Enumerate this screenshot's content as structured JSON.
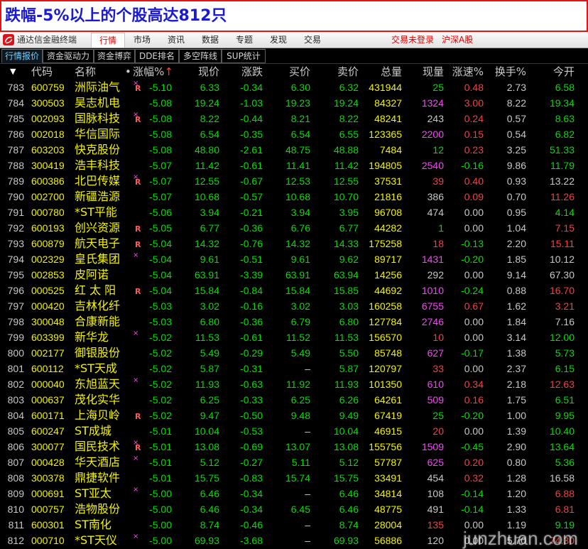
{
  "banner": {
    "text": "跌幅-5%以上的个股高达812只"
  },
  "menubar": {
    "logo_icon": "tdx-logo-icon",
    "app_title": "通达信金融终端",
    "tabs": [
      "行情",
      "市场",
      "资讯",
      "数据",
      "专题",
      "发现",
      "交易"
    ],
    "active_tab": 0,
    "login_status": "交易未登录",
    "market": "沪深A股"
  },
  "subtabs": {
    "items": [
      "行情报价",
      "资金驱动力",
      "资金博弈",
      "DDE排名",
      "多空阵线",
      "SUP统计"
    ],
    "active": 0
  },
  "table": {
    "columns": {
      "sort_icon": "▼",
      "code": "代码",
      "name": "名称",
      "dot": "•",
      "pct": "涨幅%",
      "pct_arrow": "↑",
      "price": "现价",
      "chg": "涨跌",
      "bid": "买价",
      "ask": "卖价",
      "vol": "总量",
      "cur_vol": "现量",
      "speed": "涨速%",
      "turnover": "换手%",
      "open": "今开"
    },
    "rows": [
      {
        "no": "783",
        "code": "600759",
        "name": "洲际油气",
        "mx": "×",
        "mr": "R",
        "pct": "-5.10",
        "price": "6.33",
        "chg": "-0.34",
        "bid": "6.30",
        "ask": "6.32",
        "vol": "431944",
        "cur_vol": "25",
        "cur_vol_color": "#00e000",
        "speed": "0.48",
        "turn": "2.73",
        "open": "6.58"
      },
      {
        "no": "784",
        "code": "300503",
        "name": "昊志机电",
        "pct": "-5.08",
        "price": "19.24",
        "chg": "-1.03",
        "bid": "19.23",
        "ask": "19.24",
        "vol": "84327",
        "cur_vol": "1324",
        "cur_vol_color": "#ff40ff",
        "speed": "3.00",
        "turn": "8.22",
        "open": "19.34"
      },
      {
        "no": "785",
        "code": "002093",
        "name": "国脉科技",
        "mx": "×",
        "mr": "R",
        "pct": "-5.08",
        "price": "8.22",
        "chg": "-0.44",
        "bid": "8.21",
        "ask": "8.22",
        "vol": "48241",
        "cur_vol": "243",
        "cur_vol_color": "#c8c8c8",
        "speed": "0.24",
        "turn": "0.57",
        "open": "8.63"
      },
      {
        "no": "786",
        "code": "002018",
        "name": "华信国际",
        "pct": "-5.08",
        "price": "6.54",
        "chg": "-0.35",
        "bid": "6.54",
        "ask": "6.55",
        "vol": "123365",
        "cur_vol": "2200",
        "cur_vol_color": "#ff40ff",
        "speed": "0.15",
        "turn": "0.54",
        "open": "6.82"
      },
      {
        "no": "787",
        "code": "603203",
        "name": "快克股份",
        "pct": "-5.08",
        "price": "48.80",
        "chg": "-2.61",
        "bid": "48.75",
        "ask": "48.88",
        "vol": "7484",
        "cur_vol": "12",
        "cur_vol_color": "#00e000",
        "speed": "0.23",
        "turn": "3.25",
        "open": "51.33"
      },
      {
        "no": "788",
        "code": "300419",
        "name": "浩丰科技",
        "pct": "-5.07",
        "price": "11.42",
        "chg": "-0.61",
        "bid": "11.41",
        "ask": "11.42",
        "vol": "194805",
        "cur_vol": "2540",
        "cur_vol_color": "#ff40ff",
        "speed": "-0.16",
        "turn": "9.86",
        "open": "11.79"
      },
      {
        "no": "789",
        "code": "600386",
        "name": "北巴传媒",
        "mx": "×",
        "mr": "R",
        "pct": "-5.07",
        "price": "12.55",
        "chg": "-0.67",
        "bid": "12.53",
        "ask": "12.55",
        "vol": "37531",
        "cur_vol": "39",
        "cur_vol_color": "#ff3c3c",
        "speed": "0.40",
        "turn": "0.93",
        "open": "13.22"
      },
      {
        "no": "790",
        "code": "002700",
        "name": "新疆浩源",
        "pct": "-5.07",
        "price": "10.68",
        "chg": "-0.57",
        "bid": "10.68",
        "ask": "10.70",
        "vol": "21816",
        "cur_vol": "386",
        "cur_vol_color": "#c8c8c8",
        "speed": "0.09",
        "turn": "0.70",
        "open": "11.26"
      },
      {
        "no": "791",
        "code": "000780",
        "name": "*ST平能",
        "pct": "-5.06",
        "price": "3.94",
        "chg": "-0.21",
        "bid": "3.94",
        "ask": "3.95",
        "vol": "96708",
        "cur_vol": "474",
        "cur_vol_color": "#c8c8c8",
        "speed": "0.00",
        "turn": "0.95",
        "open": "4.14"
      },
      {
        "no": "792",
        "code": "600193",
        "name": "创兴资源",
        "mr": "R",
        "pct": "-5.05",
        "price": "6.77",
        "chg": "-0.36",
        "bid": "6.76",
        "ask": "6.77",
        "vol": "44282",
        "cur_vol": "1",
        "cur_vol_color": "#00e000",
        "speed": "0.00",
        "turn": "1.04",
        "open": "7.15"
      },
      {
        "no": "793",
        "code": "600879",
        "name": "航天电子",
        "mr": "R",
        "pct": "-5.04",
        "price": "14.32",
        "chg": "-0.76",
        "bid": "14.32",
        "ask": "14.33",
        "vol": "175258",
        "cur_vol": "18",
        "cur_vol_color": "#ff3c3c",
        "speed": "-0.13",
        "turn": "2.20",
        "open": "15.11"
      },
      {
        "no": "794",
        "code": "002329",
        "name": "皇氏集团",
        "mx": "×",
        "pct": "-5.04",
        "price": "9.61",
        "chg": "-0.51",
        "bid": "9.61",
        "ask": "9.62",
        "vol": "89717",
        "cur_vol": "1431",
        "cur_vol_color": "#ff40ff",
        "speed": "-0.20",
        "turn": "1.85",
        "open": "10.12"
      },
      {
        "no": "795",
        "code": "002853",
        "name": "皮阿诺",
        "pct": "-5.04",
        "price": "63.91",
        "chg": "-3.39",
        "bid": "63.91",
        "ask": "63.94",
        "vol": "14256",
        "cur_vol": "292",
        "cur_vol_color": "#c8c8c8",
        "speed": "0.00",
        "turn": "9.14",
        "open": "67.30"
      },
      {
        "no": "796",
        "code": "000525",
        "name": "红 太 阳",
        "mr": "R",
        "pct": "-5.04",
        "price": "15.84",
        "chg": "-0.84",
        "bid": "15.84",
        "ask": "15.85",
        "vol": "44692",
        "cur_vol": "1010",
        "cur_vol_color": "#ff40ff",
        "speed": "-0.24",
        "turn": "0.88",
        "open": "16.70"
      },
      {
        "no": "797",
        "code": "000420",
        "name": "吉林化纤",
        "pct": "-5.03",
        "price": "3.02",
        "chg": "-0.16",
        "bid": "3.02",
        "ask": "3.03",
        "vol": "160258",
        "cur_vol": "6755",
        "cur_vol_color": "#ff40ff",
        "speed": "0.67",
        "turn": "1.62",
        "open": "3.21"
      },
      {
        "no": "798",
        "code": "300048",
        "name": "合康新能",
        "pct": "-5.03",
        "price": "6.80",
        "chg": "-0.36",
        "bid": "6.79",
        "ask": "6.80",
        "vol": "127784",
        "cur_vol": "2746",
        "cur_vol_color": "#ff40ff",
        "speed": "0.00",
        "turn": "1.84",
        "open": "7.16"
      },
      {
        "no": "799",
        "code": "603399",
        "name": "新华龙",
        "mx": "×",
        "pct": "-5.02",
        "price": "11.53",
        "chg": "-0.61",
        "bid": "11.52",
        "ask": "11.53",
        "vol": "156570",
        "cur_vol": "10",
        "cur_vol_color": "#ff3c3c",
        "speed": "0.00",
        "turn": "3.14",
        "open": "12.00"
      },
      {
        "no": "800",
        "code": "002177",
        "name": "御银股份",
        "pct": "-5.02",
        "price": "5.49",
        "chg": "-0.29",
        "bid": "5.49",
        "ask": "5.50",
        "vol": "85748",
        "cur_vol": "627",
        "cur_vol_color": "#ff40ff",
        "speed": "-0.17",
        "turn": "1.38",
        "open": "5.73"
      },
      {
        "no": "801",
        "code": "600112",
        "name": "*ST天成",
        "pct": "-5.02",
        "price": "5.87",
        "chg": "-0.31",
        "bid": "–",
        "ask": "5.87",
        "vol": "120797",
        "cur_vol": "33",
        "cur_vol_color": "#ff3c3c",
        "speed": "0.00",
        "turn": "2.37",
        "open": "6.15"
      },
      {
        "no": "802",
        "code": "000040",
        "name": "东旭蓝天",
        "mx": "×",
        "pct": "-5.02",
        "price": "11.93",
        "chg": "-0.63",
        "bid": "11.92",
        "ask": "11.93",
        "vol": "101350",
        "cur_vol": "610",
        "cur_vol_color": "#ff40ff",
        "speed": "0.34",
        "turn": "2.18",
        "open": "12.63"
      },
      {
        "no": "803",
        "code": "000637",
        "name": "茂化实华",
        "pct": "-5.02",
        "price": "6.25",
        "chg": "-0.33",
        "bid": "6.25",
        "ask": "6.26",
        "vol": "64261",
        "cur_vol": "509",
        "cur_vol_color": "#ff40ff",
        "speed": "0.16",
        "turn": "1.75",
        "open": "6.51"
      },
      {
        "no": "804",
        "code": "600171",
        "name": "上海贝岭",
        "mr": "R",
        "pct": "-5.02",
        "price": "9.47",
        "chg": "-0.50",
        "bid": "9.48",
        "ask": "9.49",
        "vol": "67419",
        "cur_vol": "25",
        "cur_vol_color": "#00e000",
        "speed": "-0.20",
        "turn": "1.00",
        "open": "9.95"
      },
      {
        "no": "805",
        "code": "600247",
        "name": "ST成城",
        "pct": "-5.01",
        "price": "10.04",
        "chg": "-0.53",
        "bid": "–",
        "ask": "10.04",
        "vol": "46915",
        "cur_vol": "20",
        "cur_vol_color": "#ff3c3c",
        "speed": "0.00",
        "turn": "1.39",
        "open": "10.40"
      },
      {
        "no": "806",
        "code": "300077",
        "name": "国民技术",
        "mx": "×",
        "mr": "R",
        "pct": "-5.01",
        "price": "13.08",
        "chg": "-0.69",
        "bid": "13.07",
        "ask": "13.08",
        "vol": "155756",
        "cur_vol": "1509",
        "cur_vol_color": "#ff40ff",
        "speed": "-0.45",
        "turn": "2.90",
        "open": "13.64"
      },
      {
        "no": "807",
        "code": "000428",
        "name": "华天酒店",
        "mx": "×",
        "pct": "-5.01",
        "price": "5.12",
        "chg": "-0.27",
        "bid": "5.11",
        "ask": "5.12",
        "vol": "57787",
        "cur_vol": "625",
        "cur_vol_color": "#ff40ff",
        "speed": "0.20",
        "turn": "0.80",
        "open": "5.36"
      },
      {
        "no": "808",
        "code": "300378",
        "name": "鼎捷软件",
        "pct": "-5.01",
        "price": "15.75",
        "chg": "-0.83",
        "bid": "15.74",
        "ask": "15.75",
        "vol": "33491",
        "cur_vol": "454",
        "cur_vol_color": "#c8c8c8",
        "speed": "0.32",
        "turn": "1.28",
        "open": "16.58"
      },
      {
        "no": "809",
        "code": "000691",
        "name": "ST亚太",
        "mx": "×",
        "pct": "-5.00",
        "price": "6.46",
        "chg": "-0.34",
        "bid": "–",
        "ask": "6.46",
        "vol": "34814",
        "cur_vol": "108",
        "cur_vol_color": "#c8c8c8",
        "speed": "-0.14",
        "turn": "1.20",
        "open": "6.88"
      },
      {
        "no": "810",
        "code": "000757",
        "name": "浩物股份",
        "pct": "-5.00",
        "price": "6.46",
        "chg": "-0.34",
        "bid": "6.45",
        "ask": "6.46",
        "vol": "48775",
        "cur_vol": "491",
        "cur_vol_color": "#c8c8c8",
        "speed": "-0.14",
        "turn": "1.33",
        "open": "6.81"
      },
      {
        "no": "811",
        "code": "600301",
        "name": "ST南化",
        "pct": "-5.00",
        "price": "8.74",
        "chg": "-0.46",
        "bid": "–",
        "ask": "8.74",
        "vol": "28004",
        "cur_vol": "135",
        "cur_vol_color": "#ff3c3c",
        "speed": "0.00",
        "turn": "1.19",
        "open": "9.19"
      },
      {
        "no": "812",
        "code": "000710",
        "name": "*ST天仪",
        "mx": "×",
        "pct": "-5.00",
        "price": "69.93",
        "chg": "-3.68",
        "bid": "–",
        "ask": "69.93",
        "vol": "56886",
        "cur_vol": "120",
        "cur_vol_color": "#c8c8c8",
        "speed": "0.00",
        "turn": "5.70",
        "open": "74.30"
      }
    ]
  },
  "watermark": "junzhuan.com",
  "colors": {
    "up": "#ff3c3c",
    "down": "#00e000",
    "flat": "#c8c8c8",
    "code": "#f2f200",
    "volume": "#f2f200",
    "mark_x": "#ff40ff",
    "mark_r": "#ff5a5a",
    "active_tab": "#e00000",
    "active_subtab": "#6fd0ff",
    "header_arrow": "#ff3c3c"
  }
}
